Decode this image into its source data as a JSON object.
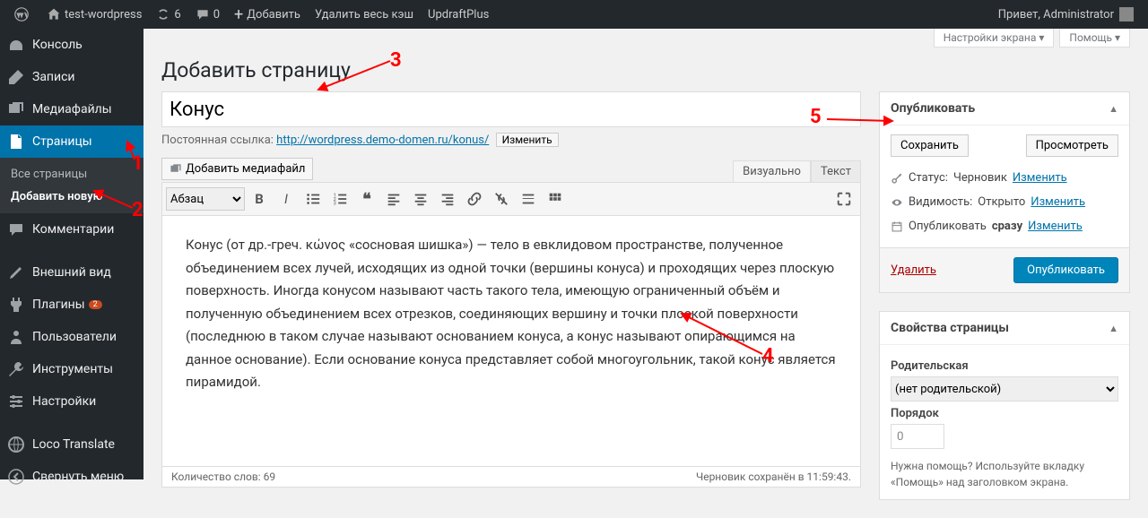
{
  "adminbar": {
    "site_name": "test-wordpress",
    "updates": "6",
    "comments": "0",
    "new": "Добавить",
    "cache": "Удалить весь кэш",
    "updraft": "UpdraftPlus",
    "greet": "Привет, Administrator"
  },
  "menu": {
    "dashboard": "Консоль",
    "posts": "Записи",
    "media": "Медиафайлы",
    "pages": "Страницы",
    "pages_all": "Все страницы",
    "pages_new": "Добавить новую",
    "comments": "Комментарии",
    "appearance": "Внешний вид",
    "plugins": "Плагины",
    "plugins_badge": "2",
    "users": "Пользователи",
    "tools": "Инструменты",
    "settings": "Настройки",
    "loco": "Loco Translate",
    "collapse": "Свернуть меню"
  },
  "screen": {
    "options": "Настройки экрана",
    "help": "Помощь"
  },
  "page": {
    "heading": "Добавить страницу",
    "title": "Конус",
    "permalink_label": "Постоянная ссылка:",
    "permalink": "http://wordpress.demo-domen.ru/konus/",
    "permalink_edit": "Изменить",
    "add_media": "Добавить медиафайл",
    "tab_visual": "Визуально",
    "tab_text": "Текст",
    "format_sel": "Абзац",
    "content": "Конус (от др.-греч. κώνος «сосновая шишка») — тело в евклидовом пространстве, полученное объединением всех лучей, исходящих из одной точки (вершины конуса) и проходящих через плоскую поверхность. Иногда конусом называют часть такого тела, имеющую ограниченный объём и полученную объединением всех отрезков, соединяющих вершину и точки плоской поверхности (последнюю в таком случае называют основанием конуса, а конус называют опирающимся на данное основание). Если основание конуса представляет собой многоугольник, такой конус является пирамидой.",
    "wordcount": "Количество слов: 69",
    "draft_saved": "Черновик сохранён в 11:59:43."
  },
  "publish": {
    "title": "Опубликовать",
    "save": "Сохранить",
    "preview": "Просмотреть",
    "status_label": "Статус:",
    "status_val": "Черновик",
    "visibility_label": "Видимость:",
    "visibility_val": "Открыто",
    "schedule_label": "Опубликовать",
    "schedule_val": "сразу",
    "edit": "Изменить",
    "delete": "Удалить",
    "publish": "Опубликовать"
  },
  "attrs": {
    "title": "Свойства страницы",
    "parent_label": "Родительская",
    "parent_val": "(нет родительской)",
    "order_label": "Порядок",
    "order_val": "0",
    "help": "Нужна помощь? Используйте вкладку «Помощь» над заголовком экрана."
  },
  "annot": {
    "n1": "1",
    "n2": "2",
    "n3": "3",
    "n4": "4",
    "n5": "5"
  }
}
